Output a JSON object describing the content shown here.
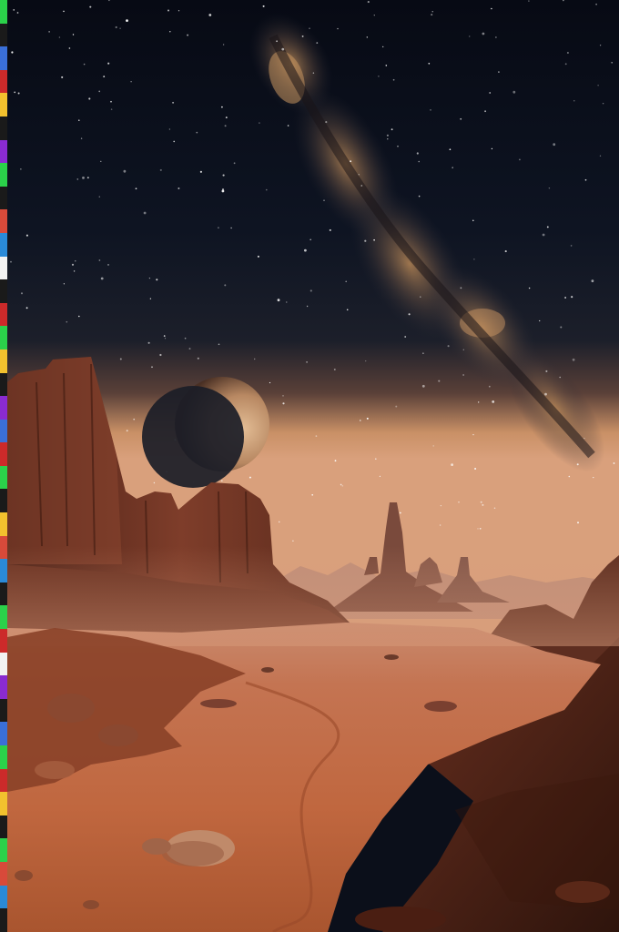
{
  "scene": {
    "description_tag": "alien-desert-landscape",
    "colors": {
      "sky_top": "#070a14",
      "sky_mid": "#121827",
      "horizon_glow": "#c99066",
      "milky_way_core": "#a97a52",
      "moon_light": "#d8b08a",
      "moon_dark": "#5a3a28",
      "sand_near": "#c4683e",
      "sand_far": "#b9755a",
      "rock_shadow": "#5b2a1c",
      "rock_lit": "#8e4a33",
      "haze": "#d79a7a"
    },
    "edge_strip_colors": [
      "#2bd14a",
      "#1a1a1a",
      "#3a6fd8",
      "#cc2a2a",
      "#f2c12e",
      "#1a1a1a",
      "#8a2bd1",
      "#2bd14a",
      "#1a1a1a",
      "#d84a3a",
      "#2a8ad8",
      "#f2f2f2",
      "#1a1a1a",
      "#cc2a2a",
      "#2bd14a",
      "#f2c12e",
      "#1a1a1a",
      "#8a2bd1",
      "#3a6fd8",
      "#cc2a2a",
      "#2bd14a",
      "#1a1a1a",
      "#f2c12e",
      "#d84a3a",
      "#2a8ad8",
      "#1a1a1a",
      "#2bd14a",
      "#cc2a2a",
      "#f2f2f2",
      "#8a2bd1",
      "#1a1a1a",
      "#3a6fd8",
      "#2bd14a",
      "#cc2a2a",
      "#f2c12e",
      "#1a1a1a",
      "#2bd14a",
      "#d84a3a",
      "#2a8ad8",
      "#1a1a1a"
    ]
  }
}
